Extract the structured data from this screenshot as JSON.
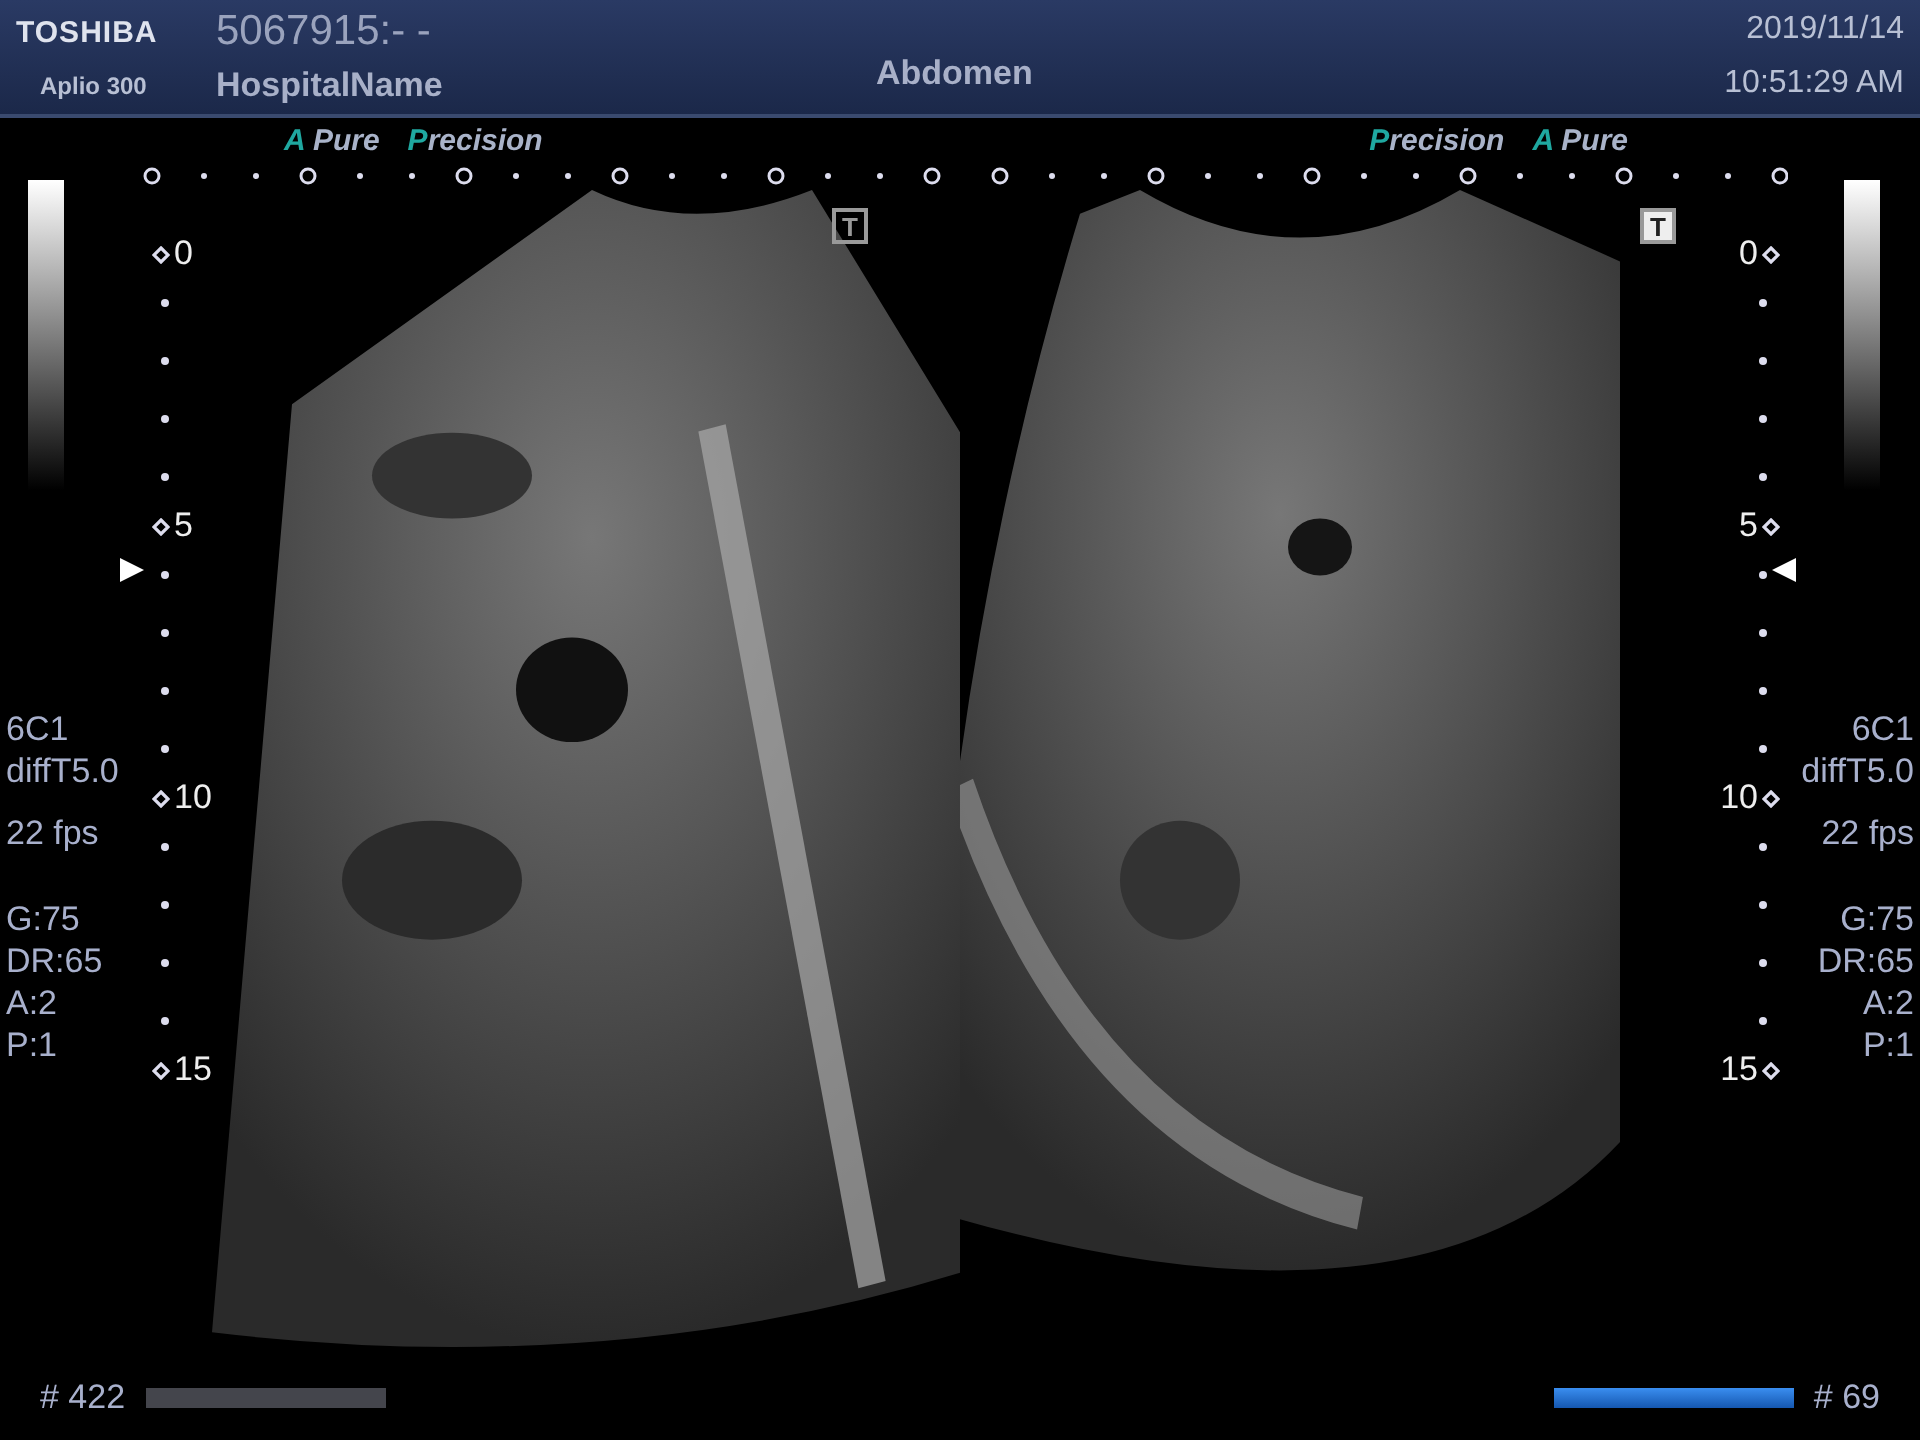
{
  "header": {
    "brand": "TOSHIBA",
    "model": "Aplio 300",
    "patient_id": "5067915:- -",
    "hospital": "HospitalName",
    "exam": "Abdomen",
    "date": "2019/11/14",
    "time": "10:51:29 AM"
  },
  "sides": [
    {
      "info": [
        "6C1",
        "diffT5.0",
        "22 fps"
      ],
      "params": [
        "G:75",
        "DR:65",
        "A:2",
        "P:1"
      ]
    },
    {
      "info": [
        "6C1",
        "diffT5.0",
        "22 fps"
      ],
      "params": [
        "G:75",
        "DR:65",
        "A:2",
        "P:1"
      ]
    }
  ],
  "views": [
    {
      "kind": "left",
      "active": false,
      "badges": [
        "A Pure",
        "Precision"
      ],
      "marker": "T",
      "depths": [
        "0",
        "5",
        "10",
        "15"
      ]
    },
    {
      "kind": "right",
      "active": true,
      "badges": [
        "Precision",
        "A Pure"
      ],
      "marker": "T",
      "depths": [
        "0",
        "5",
        "10",
        "15"
      ]
    }
  ],
  "footer": [
    {
      "text": "# 422",
      "level": 1,
      "active": false
    },
    {
      "text": "# 69",
      "level": 1,
      "active": true
    }
  ]
}
